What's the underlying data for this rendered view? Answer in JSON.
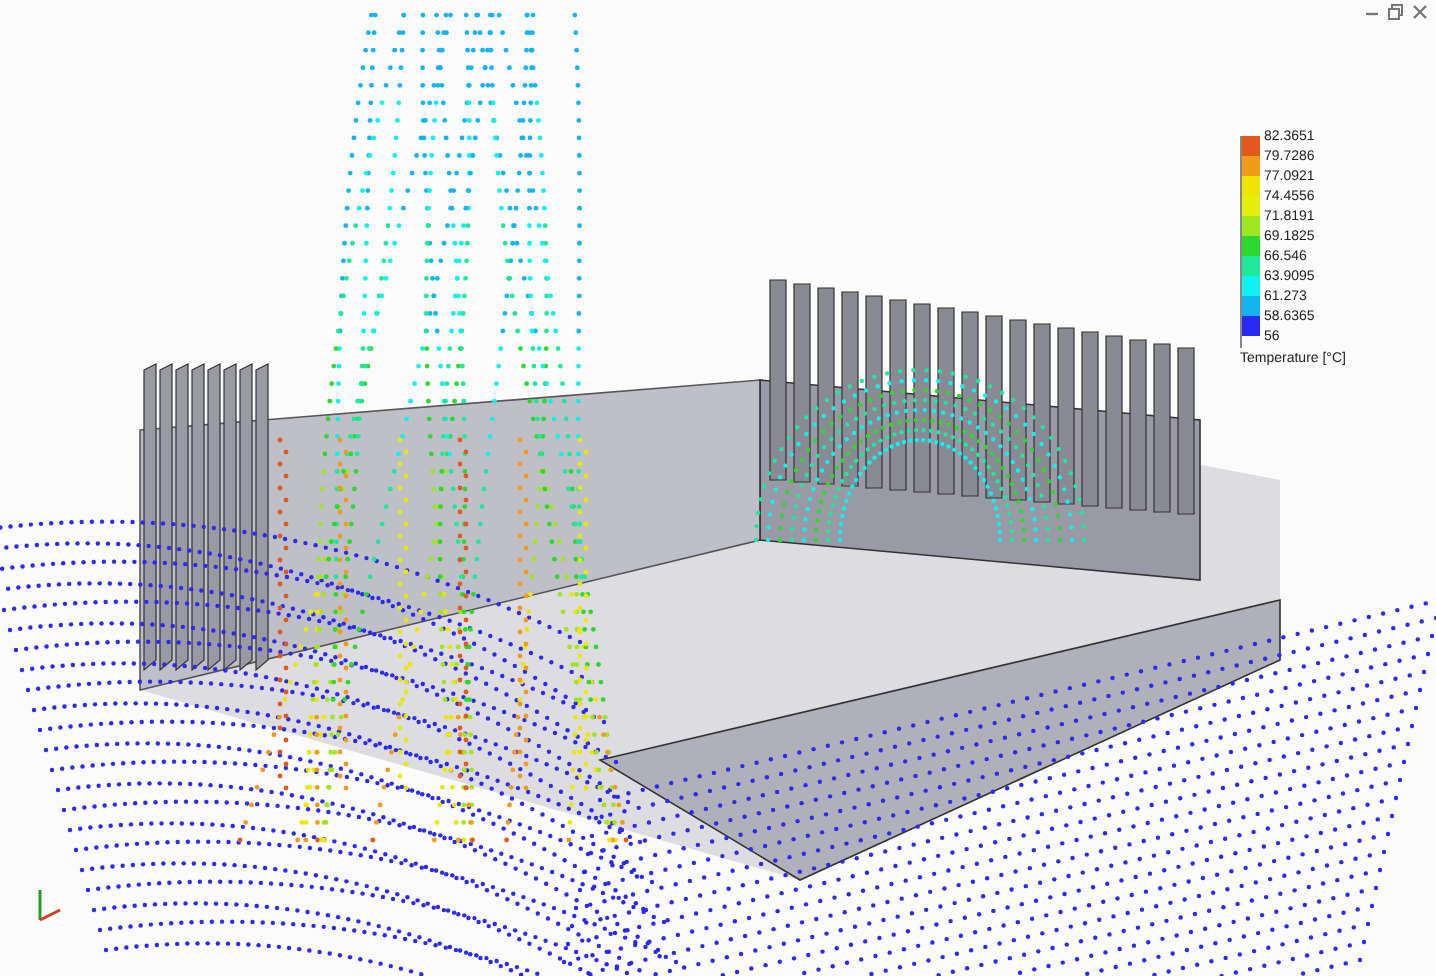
{
  "legend": {
    "title": "Temperature [°C]",
    "labels": [
      "82.3651",
      "79.7286",
      "77.0921",
      "74.4556",
      "71.8191",
      "69.1825",
      "66.546",
      "63.9095",
      "61.273",
      "58.6365",
      "56"
    ],
    "bands": [
      {
        "color": "#e2591b"
      },
      {
        "color": "#f29a1c"
      },
      {
        "color": "#ece600"
      },
      {
        "color": "#e6ee10"
      },
      {
        "color": "#9ee61e"
      },
      {
        "color": "#2ed82e"
      },
      {
        "color": "#1ee89a"
      },
      {
        "color": "#10f0ee"
      },
      {
        "color": "#14b4f0"
      },
      {
        "color": "#2a2af2"
      }
    ]
  }
}
